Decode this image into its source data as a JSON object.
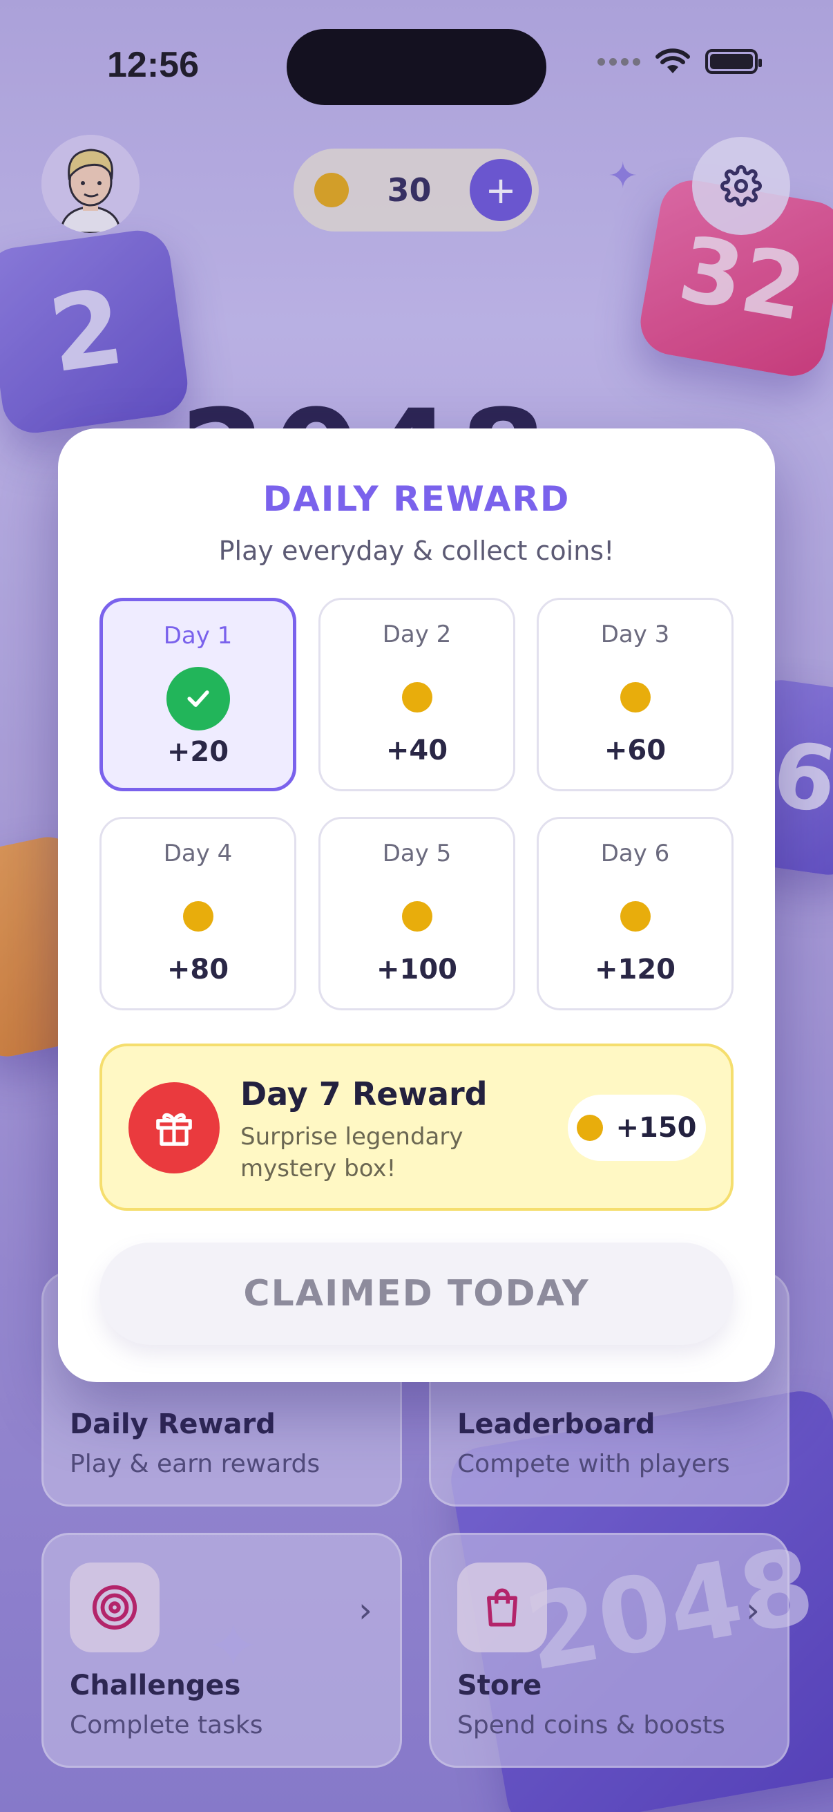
{
  "status_bar": {
    "time": "12:56"
  },
  "header": {
    "coins": "30",
    "plus_label": "+"
  },
  "background": {
    "tile_2": "2",
    "tile_32": "32",
    "tile_6": "6",
    "tile_2048": "2048",
    "game_title": "2048"
  },
  "menu": [
    {
      "title": "Daily Reward",
      "subtitle": "Play & earn rewards"
    },
    {
      "title": "Leaderboard",
      "subtitle": "Compete with players"
    },
    {
      "title": "Challenges",
      "subtitle": "Complete tasks",
      "icon": "target-icon"
    },
    {
      "title": "Store",
      "subtitle": "Spend coins & boosts",
      "icon": "shopping-bag-icon"
    }
  ],
  "modal": {
    "title": "DAILY REWARD",
    "subtitle": "Play everyday & collect coins!",
    "days": [
      {
        "label": "Day 1",
        "amount": "+20",
        "claimed": true
      },
      {
        "label": "Day 2",
        "amount": "+40",
        "claimed": false
      },
      {
        "label": "Day 3",
        "amount": "+60",
        "claimed": false
      },
      {
        "label": "Day 4",
        "amount": "+80",
        "claimed": false
      },
      {
        "label": "Day 5",
        "amount": "+100",
        "claimed": false
      },
      {
        "label": "Day 6",
        "amount": "+120",
        "claimed": false
      }
    ],
    "bonus": {
      "title": "Day 7 Reward",
      "subtitle": "Surprise legendary mystery box!",
      "amount": "+150"
    },
    "button_label": "CLAIMED TODAY"
  },
  "colors": {
    "accent": "#7a62ec",
    "coin": "#e8ad0c",
    "success": "#22b55a",
    "gift": "#ea3a3e",
    "bonus_bg": "#fff8c4"
  }
}
